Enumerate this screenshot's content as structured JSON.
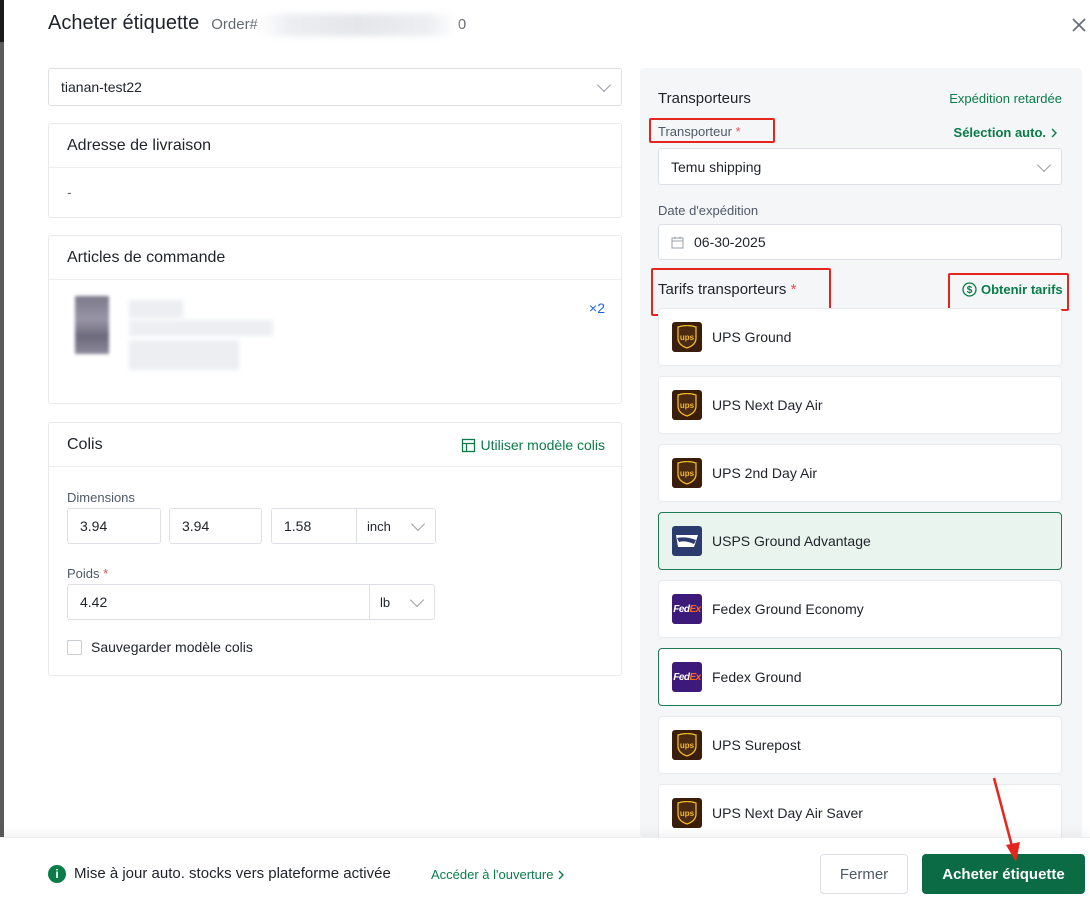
{
  "header": {
    "title": "Acheter étiquette",
    "order_prefix": "Order#",
    "order_suffix": "0"
  },
  "store_select": {
    "value": "tianan-test22"
  },
  "address_card": {
    "title": "Adresse de livraison",
    "value": "-"
  },
  "items_card": {
    "title": "Articles de commande",
    "quantity": "×2"
  },
  "package_card": {
    "title": "Colis",
    "template_link": "Utiliser modèle colis",
    "dimensions_label": "Dimensions",
    "length": "3.94",
    "width": "3.94",
    "height": "1.58",
    "dim_unit": "inch",
    "weight_label": "Poids",
    "weight_required": "*",
    "weight": "4.42",
    "weight_unit": "lb",
    "save_template_label": "Sauvegarder modèle colis"
  },
  "carriers_panel": {
    "title": "Transporteurs",
    "delayed_link": "Expédition retardée",
    "carrier_label": "Transporteur",
    "carrier_required": "*",
    "auto_select_link": "Sélection auto.",
    "carrier_value": "Temu shipping",
    "date_label": "Date d'expédition",
    "date_value": "06-30-2025",
    "rates_title": "Tarifs transporteurs",
    "rates_required": "*",
    "get_rates_button": "Obtenir tarifs",
    "rates": [
      {
        "name": "UPS Ground",
        "logo": "ups-icon"
      },
      {
        "name": "UPS Next Day Air",
        "logo": "ups-icon"
      },
      {
        "name": "UPS 2nd Day Air",
        "logo": "ups-icon"
      },
      {
        "name": "USPS Ground Advantage",
        "logo": "usps-icon"
      },
      {
        "name": "Fedex Ground Economy",
        "logo": "fedex-icon"
      },
      {
        "name": "Fedex Ground",
        "logo": "fedex-icon"
      },
      {
        "name": "UPS Surepost",
        "logo": "ups-icon"
      },
      {
        "name": "UPS Next Day Air Saver",
        "logo": "ups-icon"
      }
    ]
  },
  "footer": {
    "info_text": "Mise à jour auto. stocks vers plateforme activée",
    "open_link": "Accéder à l'ouverture",
    "close_button": "Fermer",
    "buy_button": "Acheter étiquette"
  },
  "colors": {
    "accent": "#0a6b44",
    "annotation": "#e5261f",
    "link": "#0a7c4a"
  }
}
